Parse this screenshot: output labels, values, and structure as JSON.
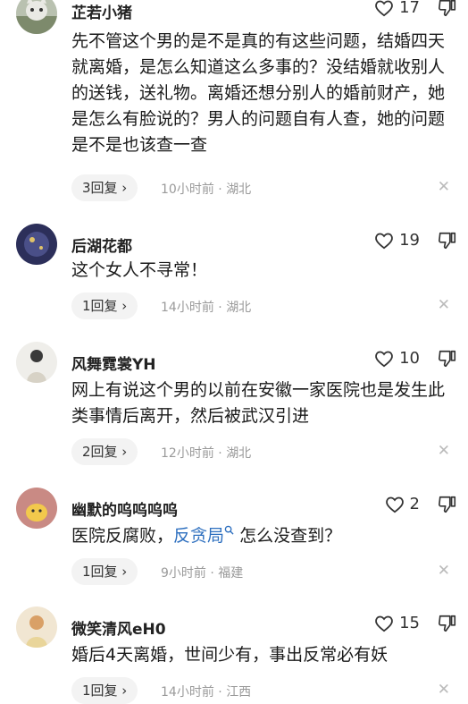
{
  "comments": [
    {
      "username": "芷若小猪",
      "likes": "17",
      "text": "先不管这个男的是不是真的有这些问题，结婚四天就离婚，是怎么知道这么多事的？没结婚就收别人的送钱，送礼物。离婚还想分别人的婚前财产，她是怎么有脸说的？男人的问题自有人查，她的问题是不是也该查一查",
      "reply_label": "3回复 ›",
      "time": "10小时前",
      "location": "湖北"
    },
    {
      "username": "后湖花都",
      "likes": "19",
      "text": "这个女人不寻常！",
      "reply_label": "1回复 ›",
      "time": "14小时前",
      "location": "湖北"
    },
    {
      "username": "风舞霓裳YH",
      "likes": "10",
      "text": "网上有说这个男的以前在安徽一家医院也是发生此类事情后离开，然后被武汉引进",
      "reply_label": "2回复 ›",
      "time": "12小时前",
      "location": "湖北"
    },
    {
      "username": "幽默的呜呜呜呜",
      "likes": "2",
      "text_before": "医院反腐败，",
      "link_text": "反贪局",
      "text_after": " 怎么没查到？",
      "reply_label": "1回复 ›",
      "time": "9小时前",
      "location": "福建"
    },
    {
      "username": "微笑清风eH0",
      "likes": "15",
      "text": "婚后4天离婚，世间少有，事出反常必有妖",
      "reply_label": "1回复 ›",
      "time": "14小时前",
      "location": "江西"
    }
  ],
  "meta_separator": "·",
  "close_glyph": "✕",
  "icons": {
    "like": "heart-outline-icon",
    "dislike": "thumbs-down-icon",
    "close": "close-icon",
    "search": "search-icon"
  },
  "colors": {
    "link": "#2d6fbf",
    "meta": "#9a9a9a",
    "pill_bg": "#f3f3f3"
  }
}
